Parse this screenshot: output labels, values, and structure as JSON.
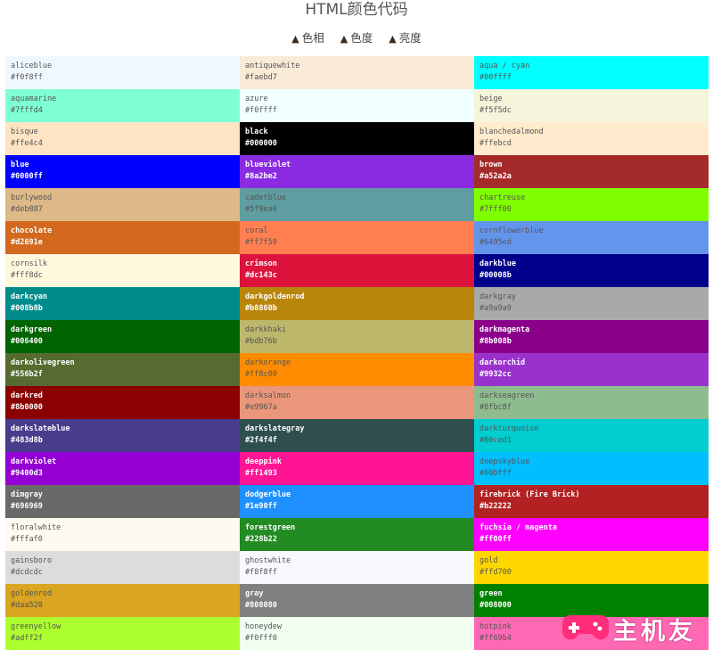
{
  "page": {
    "title": "HTML颜色代码"
  },
  "sort": {
    "hue": "色相",
    "saturation": "色度",
    "lightness": "亮度"
  },
  "colors": [
    {
      "name": "aliceblue",
      "hex": "#f0f8ff",
      "bg": "#f0f8ff",
      "text": "light"
    },
    {
      "name": "antiquewhite",
      "hex": "#faebd7",
      "bg": "#faebd7",
      "text": "light"
    },
    {
      "name": "aqua / cyan",
      "hex": "#00ffff",
      "bg": "#00ffff",
      "text": "light"
    },
    {
      "name": "aquamarine",
      "hex": "#7fffd4",
      "bg": "#7fffd4",
      "text": "light"
    },
    {
      "name": "azure",
      "hex": "#f0ffff",
      "bg": "#f0ffff",
      "text": "light"
    },
    {
      "name": "beige",
      "hex": "#f5f5dc",
      "bg": "#f5f5dc",
      "text": "light"
    },
    {
      "name": "bisque",
      "hex": "#ffe4c4",
      "bg": "#ffe4c4",
      "text": "light"
    },
    {
      "name": "black",
      "hex": "#000000",
      "bg": "#000000",
      "text": "dark"
    },
    {
      "name": "blanchedalmond",
      "hex": "#ffebcd",
      "bg": "#ffebcd",
      "text": "light"
    },
    {
      "name": "blue",
      "hex": "#0000ff",
      "bg": "#0000ff",
      "text": "dark"
    },
    {
      "name": "blueviolet",
      "hex": "#8a2be2",
      "bg": "#8a2be2",
      "text": "dark"
    },
    {
      "name": "brown",
      "hex": "#a52a2a",
      "bg": "#a52a2a",
      "text": "dark"
    },
    {
      "name": "burlywood",
      "hex": "#deb887",
      "bg": "#deb887",
      "text": "light"
    },
    {
      "name": "cadetblue",
      "hex": "#5f9ea0",
      "bg": "#5f9ea0",
      "text": "light"
    },
    {
      "name": "chartreuse",
      "hex": "#7fff00",
      "bg": "#7fff00",
      "text": "light"
    },
    {
      "name": "chocolate",
      "hex": "#d2691e",
      "bg": "#d2691e",
      "text": "dark"
    },
    {
      "name": "coral",
      "hex": "#ff7f50",
      "bg": "#ff7f50",
      "text": "light"
    },
    {
      "name": "cornflowerblue",
      "hex": "#6495ed",
      "bg": "#6495ed",
      "text": "light"
    },
    {
      "name": "cornsilk",
      "hex": "#fff8dc",
      "bg": "#fff8dc",
      "text": "light"
    },
    {
      "name": "crimson",
      "hex": "#dc143c",
      "bg": "#dc143c",
      "text": "dark"
    },
    {
      "name": "darkblue",
      "hex": "#00008b",
      "bg": "#00008b",
      "text": "dark"
    },
    {
      "name": "darkcyan",
      "hex": "#008b8b",
      "bg": "#008b8b",
      "text": "dark"
    },
    {
      "name": "darkgoldenrod",
      "hex": "#b8860b",
      "bg": "#b8860b",
      "text": "dark"
    },
    {
      "name": "darkgray",
      "hex": "#a9a9a9",
      "bg": "#a9a9a9",
      "text": "light"
    },
    {
      "name": "darkgreen",
      "hex": "#006400",
      "bg": "#006400",
      "text": "dark"
    },
    {
      "name": "darkkhaki",
      "hex": "#bdb76b",
      "bg": "#bdb76b",
      "text": "light"
    },
    {
      "name": "darkmagenta",
      "hex": "#8b008b",
      "bg": "#8b008b",
      "text": "dark"
    },
    {
      "name": "darkolivegreen",
      "hex": "#556b2f",
      "bg": "#556b2f",
      "text": "dark"
    },
    {
      "name": "darkorange",
      "hex": "#ff8c00",
      "bg": "#ff8c00",
      "text": "light"
    },
    {
      "name": "darkorchid",
      "hex": "#9932cc",
      "bg": "#9932cc",
      "text": "dark"
    },
    {
      "name": "darkred",
      "hex": "#8b0000",
      "bg": "#8b0000",
      "text": "dark"
    },
    {
      "name": "darksalmon",
      "hex": "#e9967a",
      "bg": "#e9967a",
      "text": "light"
    },
    {
      "name": "darkseagreen",
      "hex": "#8fbc8f",
      "bg": "#8fbc8f",
      "text": "light"
    },
    {
      "name": "darkslateblue",
      "hex": "#483d8b",
      "bg": "#483d8b",
      "text": "dark"
    },
    {
      "name": "darkslategray",
      "hex": "#2f4f4f",
      "bg": "#2f4f4f",
      "text": "dark"
    },
    {
      "name": "darkturquoise",
      "hex": "#00ced1",
      "bg": "#00ced1",
      "text": "light"
    },
    {
      "name": "darkviolet",
      "hex": "#9400d3",
      "bg": "#9400d3",
      "text": "dark"
    },
    {
      "name": "deeppink",
      "hex": "#ff1493",
      "bg": "#ff1493",
      "text": "dark"
    },
    {
      "name": "deepskyblue",
      "hex": "#00bfff",
      "bg": "#00bfff",
      "text": "light"
    },
    {
      "name": "dimgray",
      "hex": "#696969",
      "bg": "#696969",
      "text": "dark"
    },
    {
      "name": "dodgerblue",
      "hex": "#1e90ff",
      "bg": "#1e90ff",
      "text": "dark"
    },
    {
      "name": "firebrick (Fire Brick)",
      "hex": "#b22222",
      "bg": "#b22222",
      "text": "dark"
    },
    {
      "name": "floralwhite",
      "hex": "#fffaf0",
      "bg": "#fffaf0",
      "text": "light"
    },
    {
      "name": "forestgreen",
      "hex": "#228b22",
      "bg": "#228b22",
      "text": "dark"
    },
    {
      "name": "fuchsia / magenta",
      "hex": "#ff00ff",
      "bg": "#ff00ff",
      "text": "dark"
    },
    {
      "name": "gainsboro",
      "hex": "#dcdcdc",
      "bg": "#dcdcdc",
      "text": "light"
    },
    {
      "name": "ghostwhite",
      "hex": "#f8f8ff",
      "bg": "#f8f8ff",
      "text": "light"
    },
    {
      "name": "gold",
      "hex": "#ffd700",
      "bg": "#ffd700",
      "text": "light"
    },
    {
      "name": "goldenrod",
      "hex": "#daa520",
      "bg": "#daa520",
      "text": "light"
    },
    {
      "name": "gray",
      "hex": "#808080",
      "bg": "#808080",
      "text": "dark"
    },
    {
      "name": "green",
      "hex": "#008000",
      "bg": "#008000",
      "text": "dark"
    },
    {
      "name": "greenyellow",
      "hex": "#adff2f",
      "bg": "#adff2f",
      "text": "light"
    },
    {
      "name": "honeydew",
      "hex": "#f0fff0",
      "bg": "#f0fff0",
      "text": "light"
    },
    {
      "name": "hotpink",
      "hex": "#ff69b4",
      "bg": "#ff69b4",
      "text": "light"
    }
  ],
  "watermark": {
    "text": "主机友",
    "icon": "gamepad-icon",
    "color": "#ff2d7a"
  }
}
